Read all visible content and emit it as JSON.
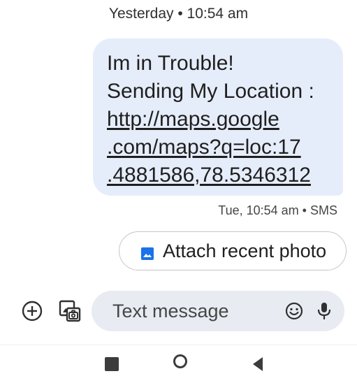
{
  "header": {
    "date_label": "Yesterday • 10:54 am"
  },
  "message": {
    "lines": [
      "Im in Trouble!",
      "Sending My Location :",
      "http://maps.google",
      ".com/maps?q=loc:17",
      ".4881586,78.5346312"
    ],
    "meta": "Tue, 10:54 am • SMS"
  },
  "suggestion": {
    "label": "Attach recent photo",
    "icon": "image-icon"
  },
  "composer": {
    "placeholder": "Text message",
    "icons": [
      "add-circle-icon",
      "gallery-icon",
      "emoji-icon",
      "microphone-icon"
    ]
  },
  "navigation": {
    "icons": [
      "recents-icon",
      "home-icon",
      "back-icon"
    ]
  },
  "colors": {
    "bubble": "#e6edfa",
    "composer_field": "#e8ecf2",
    "chip_border": "#c4c7c5",
    "accent": "#1a73e8",
    "text": "#1f1f1f"
  }
}
